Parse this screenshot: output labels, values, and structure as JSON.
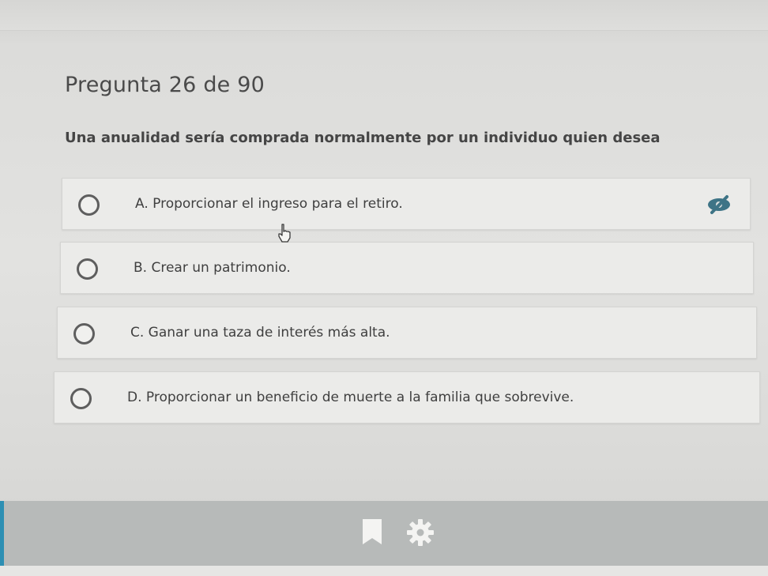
{
  "question": {
    "header": "Pregunta 26 de 90",
    "text": "Una anualidad sería comprada normalmente por un individuo quien desea"
  },
  "options": [
    {
      "label": "A. Proporcionar el ingreso para el retiro."
    },
    {
      "label": "B. Crear un patrimonio."
    },
    {
      "label": "C. Ganar una taza de interés más alta."
    },
    {
      "label": "D. Proporcionar un beneficio de muerte a la familia que sobrevive."
    }
  ],
  "icons": {
    "option_a_hint": "eye-slash-icon",
    "cursor": "hand-pointer-icon",
    "bookmark": "bookmark-icon",
    "settings": "gear-icon"
  },
  "colors": {
    "accent": "#2d8fb3",
    "option_background": "#ebebe9",
    "bottom_bar": "#b7bab9"
  }
}
